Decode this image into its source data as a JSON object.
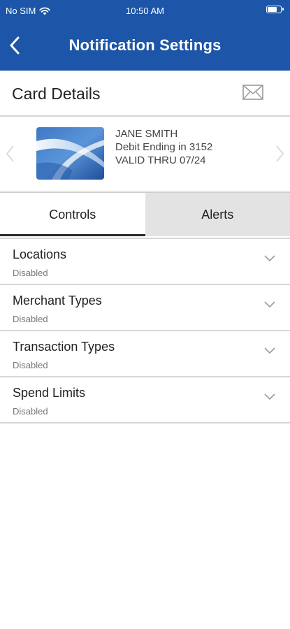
{
  "status_bar": {
    "carrier": "No SIM",
    "time": "10:50 AM"
  },
  "nav": {
    "title": "Notification Settings"
  },
  "card_section": {
    "label": "Card Details"
  },
  "card": {
    "holder": "JANE SMITH",
    "ending": "Debit Ending in 3152",
    "valid": "VALID THRU 07/24"
  },
  "tabs": [
    {
      "label": "Controls",
      "active": true
    },
    {
      "label": "Alerts",
      "active": false
    }
  ],
  "controls": [
    {
      "name": "Locations",
      "status": "Disabled"
    },
    {
      "name": "Merchant Types",
      "status": "Disabled"
    },
    {
      "name": "Transaction Types",
      "status": "Disabled"
    },
    {
      "name": "Spend Limits",
      "status": "Disabled"
    }
  ],
  "colors": {
    "header_blue": "#1d56a8",
    "tab_inactive": "#e3e3e3",
    "divider": "#d6d6d6"
  },
  "icons": {
    "back": "chevron-left-icon",
    "mail": "envelope-icon",
    "prev": "chevron-left-icon",
    "next": "chevron-right-icon",
    "expand": "chevron-down-icon",
    "wifi": "wifi-icon",
    "battery": "battery-icon"
  }
}
